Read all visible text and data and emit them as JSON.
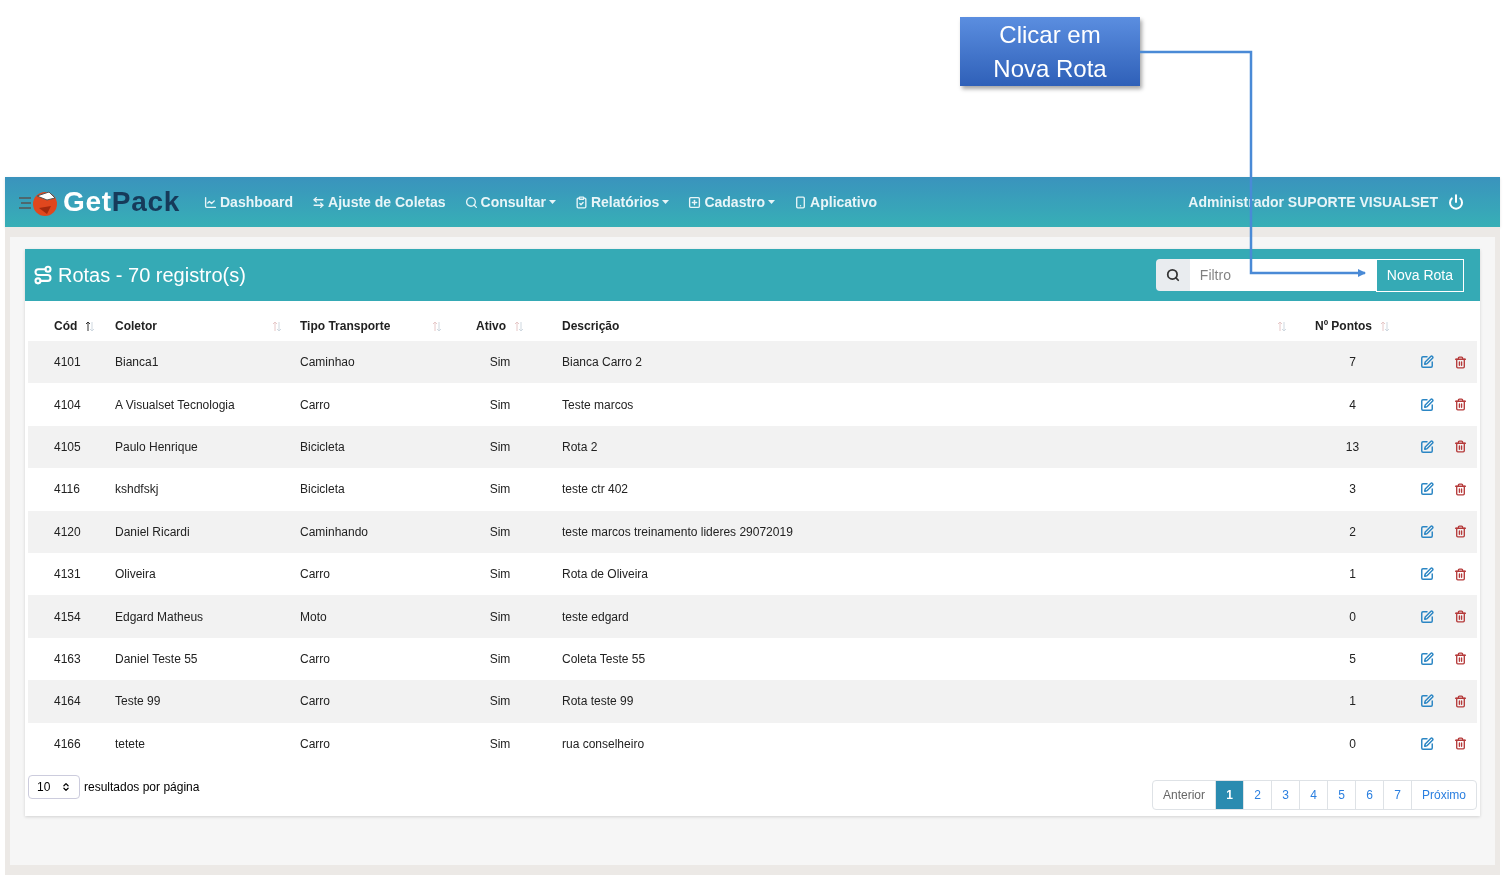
{
  "annotation": {
    "lines": [
      "Clicar em",
      "Nova Rota"
    ]
  },
  "navbar": {
    "brand": {
      "first": "Get",
      "second": "Pack"
    },
    "menu": [
      {
        "label": "Dashboard",
        "dropdown": false
      },
      {
        "label": "Ajuste de Coletas",
        "dropdown": false
      },
      {
        "label": "Consultar",
        "dropdown": true
      },
      {
        "label": "Relatórios",
        "dropdown": true
      },
      {
        "label": "Cadastro",
        "dropdown": true
      },
      {
        "label": "Aplicativo",
        "dropdown": false
      }
    ],
    "user": "Administrador SUPORTE VISUALSET"
  },
  "card": {
    "title": "Rotas - 70 registro(s)",
    "filter": {
      "placeholder": "Filtro"
    },
    "new_button": "Nova Rota"
  },
  "table": {
    "columns": [
      {
        "label": "Cód",
        "sorted": true
      },
      {
        "label": "Coletor",
        "sorted": false
      },
      {
        "label": "Tipo Transporte",
        "sorted": false
      },
      {
        "label": "Ativo",
        "sorted": false
      },
      {
        "label": "Descrição",
        "sorted": false
      },
      {
        "label": "Nº Pontos",
        "sorted": false
      }
    ],
    "rows": [
      [
        "4101",
        "Bianca1",
        "Caminhao",
        "Sim",
        "Bianca Carro 2",
        "7"
      ],
      [
        "4104",
        "A Visualset Tecnologia",
        "Carro",
        "Sim",
        "Teste marcos",
        "4"
      ],
      [
        "4105",
        "Paulo Henrique",
        "Bicicleta",
        "Sim",
        "Rota 2",
        "13"
      ],
      [
        "4116",
        "kshdfskj",
        "Bicicleta",
        "Sim",
        "teste ctr 402",
        "3"
      ],
      [
        "4120",
        "Daniel Ricardi",
        "Caminhando",
        "Sim",
        "teste marcos treinamento lideres 29072019",
        "2"
      ],
      [
        "4131",
        "Oliveira",
        "Carro",
        "Sim",
        "Rota de Oliveira",
        "1"
      ],
      [
        "4154",
        "Edgard Matheus",
        "Moto",
        "Sim",
        "teste edgard",
        "0"
      ],
      [
        "4163",
        "Daniel Teste 55",
        "Carro",
        "Sim",
        "Coleta Teste 55",
        "5"
      ],
      [
        "4164",
        "Teste 99",
        "Carro",
        "Sim",
        "Rota teste 99",
        "1"
      ],
      [
        "4166",
        "tetete",
        "Carro",
        "Sim",
        "rua conselheiro",
        "0"
      ]
    ]
  },
  "footer": {
    "page_size": "10",
    "page_size_label": "resultados por página",
    "pagination": {
      "previous": "Anterior",
      "next": "Próximo",
      "pages": [
        {
          "label": "1",
          "selected": true
        },
        {
          "label": "2",
          "selected": false
        },
        {
          "label": "3",
          "selected": false
        },
        {
          "label": "4",
          "selected": false
        },
        {
          "label": "5",
          "selected": false
        },
        {
          "label": "6",
          "selected": false
        },
        {
          "label": "7",
          "selected": false
        }
      ]
    }
  }
}
